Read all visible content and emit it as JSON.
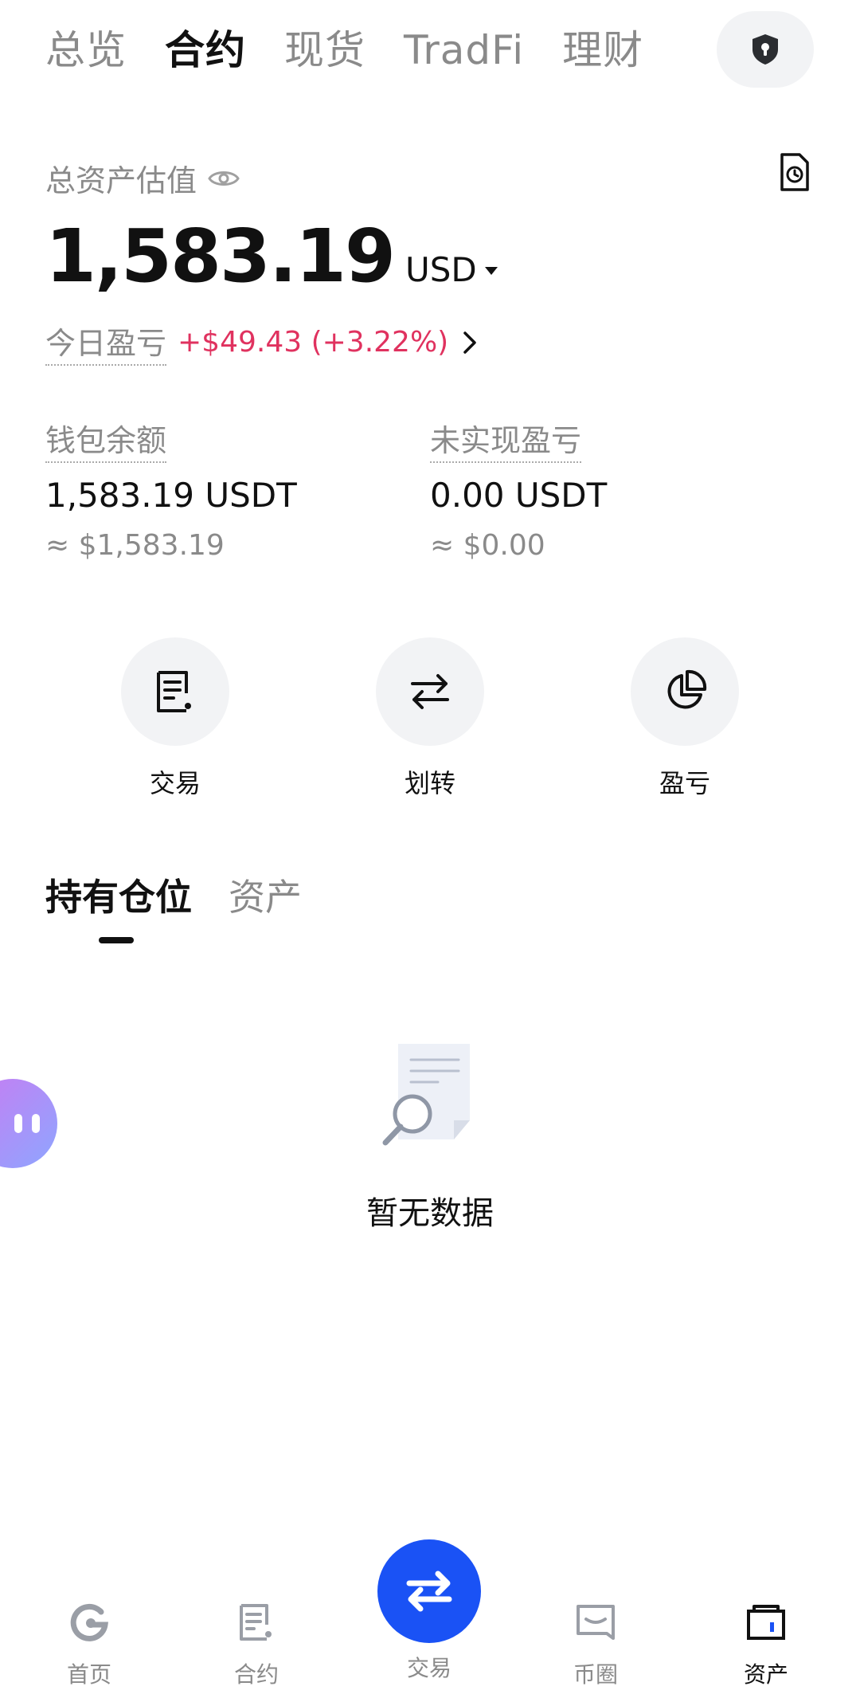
{
  "top_tabs": {
    "items": [
      {
        "label": "总览",
        "active": false
      },
      {
        "label": "合约",
        "active": true
      },
      {
        "label": "现货",
        "active": false
      },
      {
        "label": "TradFi",
        "active": false
      },
      {
        "label": "理财",
        "active": false
      }
    ],
    "shield_icon": "shield-keyhole-icon"
  },
  "summary": {
    "total_label": "总资产估值",
    "total_value": "1,583.19",
    "currency": "USD",
    "pnl_label": "今日盈亏",
    "pnl_value": "+$49.43 (+3.22%)",
    "pnl_color": "#e0325f"
  },
  "balances": {
    "wallet": {
      "label": "钱包余额",
      "value": "1,583.19 USDT",
      "approx": "≈ $1,583.19"
    },
    "unrealized": {
      "label": "未实现盈亏",
      "value": "0.00 USDT",
      "approx": "≈ $0.00"
    }
  },
  "actions": [
    {
      "label": "交易",
      "icon": "order-list-icon"
    },
    {
      "label": "划转",
      "icon": "transfer-arrows-icon"
    },
    {
      "label": "盈亏",
      "icon": "pie-chart-icon"
    }
  ],
  "section_tabs": {
    "items": [
      {
        "label": "持有仓位",
        "active": true
      },
      {
        "label": "资产",
        "active": false
      }
    ]
  },
  "empty_state": {
    "text": "暂无数据"
  },
  "bottom_nav": {
    "items": [
      {
        "label": "首页",
        "icon": "home-icon",
        "active": false
      },
      {
        "label": "合约",
        "icon": "contract-icon",
        "active": false
      },
      {
        "label": "交易",
        "icon": "swap-icon",
        "active": false
      },
      {
        "label": "币圈",
        "icon": "community-icon",
        "active": false
      },
      {
        "label": "资产",
        "icon": "wallet-icon",
        "active": true
      }
    ],
    "accent": "#1a52f5"
  }
}
